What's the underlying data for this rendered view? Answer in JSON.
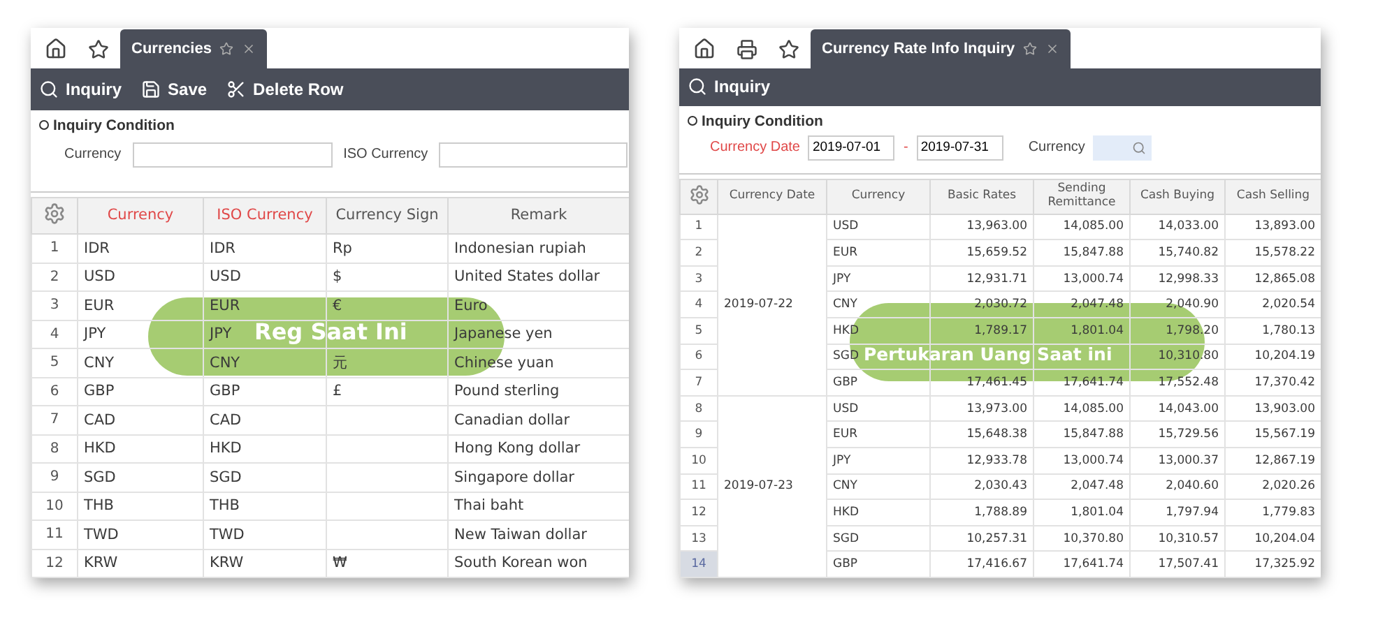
{
  "panels": [
    {
      "tab": {
        "label": "Currencies",
        "selected": true
      },
      "toolbar": [
        {
          "label": "Inquiry"
        },
        {
          "label": "Save"
        },
        {
          "label": "Delete Row"
        }
      ],
      "condition": {
        "title": "Inquiry Condition",
        "fields": [
          {
            "kind": "text",
            "label": "Currency",
            "required": false
          },
          {
            "kind": "text",
            "label": "ISO Currency",
            "required": false
          }
        ]
      },
      "table": {
        "kind": "currencies",
        "columns": [
          {
            "label": "Currency",
            "required": true
          },
          {
            "label": "ISO Currency",
            "required": true
          },
          {
            "label": "Currency Sign",
            "required": false
          },
          {
            "label": "Remark",
            "required": false
          }
        ],
        "rows": [
          {
            "no": "1",
            "selected": false,
            "cells": [
              "IDR",
              "IDR",
              "Rp",
              "Indonesian rupiah"
            ]
          },
          {
            "no": "2",
            "selected": false,
            "cells": [
              "USD",
              "USD",
              "$",
              "United States dollar"
            ]
          },
          {
            "no": "3",
            "selected": false,
            "cells": [
              "EUR",
              "EUR",
              "€",
              "Euro"
            ]
          },
          {
            "no": "4",
            "selected": false,
            "cells": [
              "JPY",
              "JPY",
              "",
              "Japanese yen"
            ]
          },
          {
            "no": "5",
            "selected": false,
            "cells": [
              "CNY",
              "CNY",
              "元",
              "Chinese yuan"
            ]
          },
          {
            "no": "6",
            "selected": false,
            "cells": [
              "GBP",
              "GBP",
              "£",
              "Pound sterling"
            ]
          },
          {
            "no": "7",
            "selected": false,
            "cells": [
              "CAD",
              "CAD",
              "",
              "Canadian dollar"
            ]
          },
          {
            "no": "8",
            "selected": false,
            "cells": [
              "HKD",
              "HKD",
              "",
              "Hong Kong dollar"
            ]
          },
          {
            "no": "9",
            "selected": false,
            "cells": [
              "SGD",
              "SGD",
              "",
              "Singapore dollar"
            ]
          },
          {
            "no": "10",
            "selected": false,
            "cells": [
              "THB",
              "THB",
              "",
              "Thai baht"
            ]
          },
          {
            "no": "11",
            "selected": false,
            "cells": [
              "TWD",
              "TWD",
              "",
              "New Taiwan dollar"
            ]
          },
          {
            "no": "12",
            "selected": false,
            "cells": [
              "KRW",
              "KRW",
              "₩",
              "South Korean won"
            ]
          }
        ]
      },
      "overlay": "Reg Saat Ini"
    },
    {
      "tab": {
        "label": "Currency Rate Info Inquiry",
        "selected": true
      },
      "toolbar": [
        {
          "label": "Inquiry"
        }
      ],
      "condition": {
        "title": "Inquiry Condition",
        "fields": [
          {
            "kind": "daterange",
            "label": "Currency Date",
            "required": true,
            "from": "2019-07-01",
            "to": "2019-07-31",
            "separator": "-"
          },
          {
            "kind": "lookup",
            "label": "Currency",
            "required": false
          }
        ]
      },
      "table": {
        "kind": "rates",
        "columns": [
          {
            "label": "Currency Date",
            "required": false
          },
          {
            "label": "Currency",
            "required": false
          },
          {
            "label": "Basic Rates",
            "required": false
          },
          {
            "label": "Sending Remittance",
            "required": false
          },
          {
            "label": "Cash Buying",
            "required": false
          },
          {
            "label": "Cash Selling",
            "required": false
          }
        ],
        "groups": [
          {
            "date": "2019-07-22",
            "rows": [
              {
                "no": "1",
                "selected": false,
                "cells": [
                  "USD",
                  "13,963.00",
                  "14,085.00",
                  "14,033.00",
                  "13,893.00"
                ]
              },
              {
                "no": "2",
                "selected": false,
                "cells": [
                  "EUR",
                  "15,659.52",
                  "15,847.88",
                  "15,740.82",
                  "15,578.22"
                ]
              },
              {
                "no": "3",
                "selected": false,
                "cells": [
                  "JPY",
                  "12,931.71",
                  "13,000.74",
                  "12,998.33",
                  "12,865.08"
                ]
              },
              {
                "no": "4",
                "selected": false,
                "cells": [
                  "CNY",
                  "2,030.72",
                  "2,047.48",
                  "2,040.90",
                  "2,020.54"
                ]
              },
              {
                "no": "5",
                "selected": false,
                "cells": [
                  "HKD",
                  "1,789.17",
                  "1,801.04",
                  "1,798.20",
                  "1,780.13"
                ]
              },
              {
                "no": "6",
                "selected": false,
                "cells": [
                  "SGD",
                  "",
                  "",
                  "10,310.80",
                  "10,204.19"
                ]
              },
              {
                "no": "7",
                "selected": false,
                "cells": [
                  "GBP",
                  "17,461.45",
                  "17,641.74",
                  "17,552.48",
                  "17,370.42"
                ]
              }
            ]
          },
          {
            "date": "2019-07-23",
            "rows": [
              {
                "no": "8",
                "selected": false,
                "cells": [
                  "USD",
                  "13,973.00",
                  "14,085.00",
                  "14,043.00",
                  "13,903.00"
                ]
              },
              {
                "no": "9",
                "selected": false,
                "cells": [
                  "EUR",
                  "15,648.38",
                  "15,847.88",
                  "15,729.56",
                  "15,567.19"
                ]
              },
              {
                "no": "10",
                "selected": false,
                "cells": [
                  "JPY",
                  "12,933.78",
                  "13,000.74",
                  "13,000.37",
                  "12,867.19"
                ]
              },
              {
                "no": "11",
                "selected": false,
                "cells": [
                  "CNY",
                  "2,030.43",
                  "2,047.48",
                  "2,040.60",
                  "2,020.26"
                ]
              },
              {
                "no": "12",
                "selected": false,
                "cells": [
                  "HKD",
                  "1,788.89",
                  "1,801.04",
                  "1,797.94",
                  "1,779.83"
                ]
              },
              {
                "no": "13",
                "selected": false,
                "cells": [
                  "SGD",
                  "10,257.31",
                  "10,370.80",
                  "10,310.57",
                  "10,204.04"
                ]
              },
              {
                "no": "14",
                "selected": true,
                "cells": [
                  "GBP",
                  "17,416.67",
                  "17,641.74",
                  "17,507.41",
                  "17,325.92"
                ]
              }
            ]
          }
        ]
      },
      "overlay": "Pertukaran Uang Saat ini"
    }
  ]
}
